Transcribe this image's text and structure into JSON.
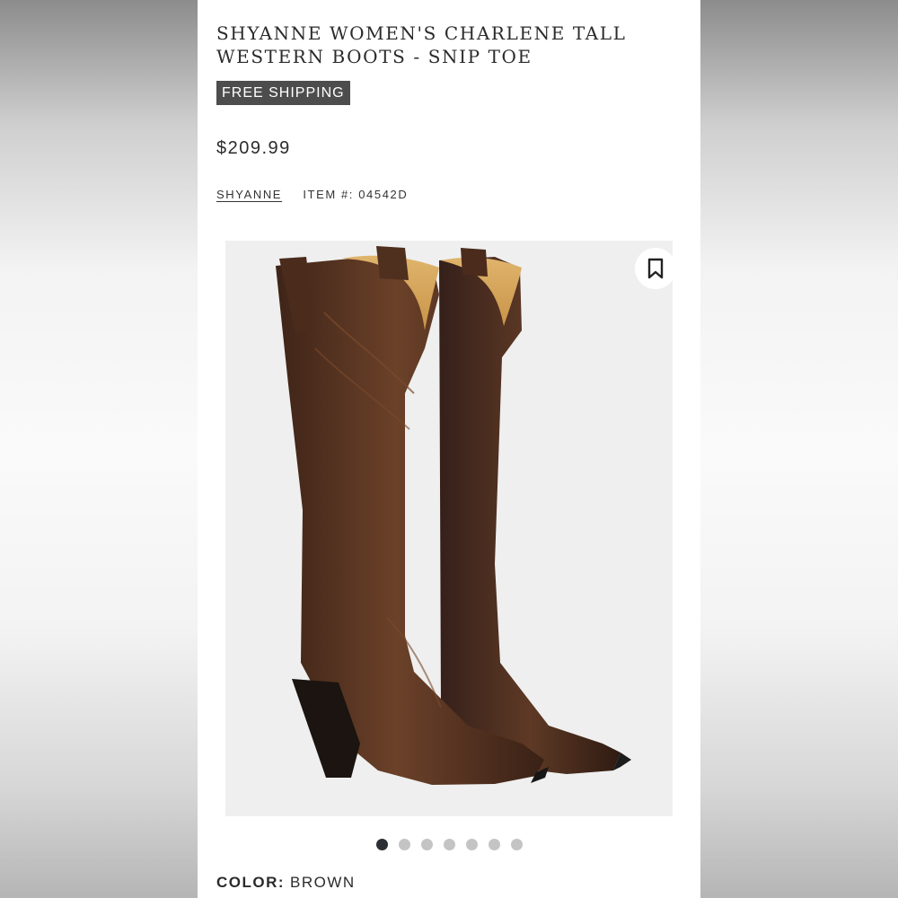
{
  "product": {
    "title": "SHYANNE WOMEN'S CHARLENE TALL WESTERN BOOTS - SNIP TOE",
    "badge": "FREE SHIPPING",
    "price": "$209.99",
    "brand": "SHYANNE",
    "item_number": "ITEM #: 04542D",
    "color_label": "COLOR:",
    "color_value": "BROWN"
  },
  "gallery": {
    "image_subject": "boots-photo",
    "dots": [
      {
        "active": true
      },
      {
        "active": false
      },
      {
        "active": false
      },
      {
        "active": false
      },
      {
        "active": false
      },
      {
        "active": false
      },
      {
        "active": false
      }
    ]
  },
  "icons": {
    "bookmark": "bookmark-icon"
  },
  "colors": {
    "badge_bg": "#4c4d4c",
    "active_dot": "#2c2f33",
    "inactive_dot": "#c4c4c4",
    "leather": "#5a3522"
  }
}
